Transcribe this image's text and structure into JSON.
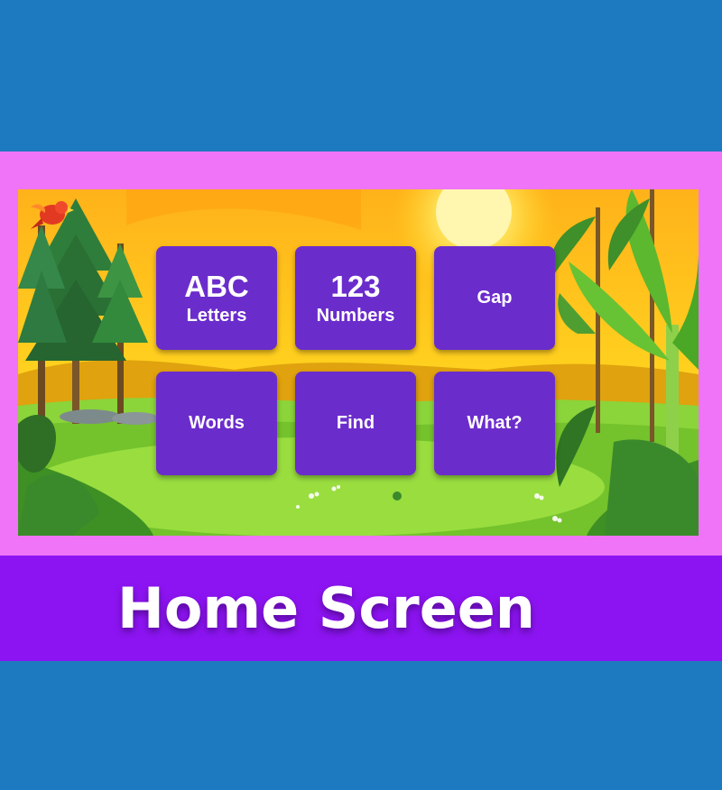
{
  "menu": {
    "letters": {
      "big": "ABC",
      "small": "Letters"
    },
    "numbers": {
      "big": "123",
      "small": "Numbers"
    },
    "gap": {
      "label": "Gap"
    },
    "words": {
      "label": "Words"
    },
    "find": {
      "label": "Find"
    },
    "what": {
      "label": "What?"
    }
  },
  "caption": {
    "text": "Home Screen"
  },
  "colors": {
    "background_blue": "#1e7ac0",
    "frame_pink": "#ef74f7",
    "card_purple": "#6b2ccc",
    "caption_band": "#8d14f2",
    "sky_orange": "#f7b40e",
    "grass_green": "#7ccb2e"
  },
  "icons": [
    "parrot-icon",
    "sun-icon",
    "pine-tree-icon",
    "banana-tree-icon",
    "bush-icon"
  ]
}
